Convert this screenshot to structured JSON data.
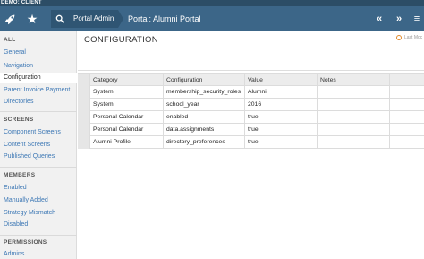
{
  "demo_bar": {
    "label": "DEMO: CLIENT"
  },
  "header": {
    "breadcrumb_label": "Portal Admin",
    "title": "Portal: Alumni Portal",
    "icons": {
      "rocket": "rocket-icon",
      "star": "star-icon",
      "search": "search-icon",
      "prev": "double-chevron-left-icon",
      "next": "double-chevron-right-icon",
      "menu": "menu-icon"
    },
    "prev_glyph": "«",
    "next_glyph": "»",
    "menu_glyph": "≡",
    "star_glyph": "★"
  },
  "sidebar": {
    "sections": [
      {
        "title": "ALL",
        "items": [
          {
            "label": "General",
            "active": false
          },
          {
            "label": "Navigation",
            "active": false
          },
          {
            "label": "Configuration",
            "active": true
          },
          {
            "label": "Parent Invoice Payment",
            "active": false
          },
          {
            "label": "Directories",
            "active": false
          }
        ]
      },
      {
        "title": "SCREENS",
        "items": [
          {
            "label": "Component Screens",
            "active": false
          },
          {
            "label": "Content Screens",
            "active": false
          },
          {
            "label": "Published Queries",
            "active": false
          }
        ]
      },
      {
        "title": "MEMBERS",
        "items": [
          {
            "label": "Enabled",
            "active": false
          },
          {
            "label": "Manually Added",
            "active": false
          },
          {
            "label": "Strategy Mismatch",
            "active": false
          },
          {
            "label": "Disabled",
            "active": false
          }
        ]
      },
      {
        "title": "PERMISSIONS",
        "items": [
          {
            "label": "Admins",
            "active": false
          }
        ]
      }
    ]
  },
  "main": {
    "page_title": "CONFIGURATION",
    "last_modified": "Last Moc",
    "table": {
      "columns": [
        "Category",
        "Configuration",
        "Value",
        "Notes"
      ],
      "rows": [
        [
          "System",
          "membership_security_roles",
          "Alumni",
          ""
        ],
        [
          "System",
          "school_year",
          "2016",
          ""
        ],
        [
          "Personal Calendar",
          "enabled",
          "true",
          ""
        ],
        [
          "Personal Calendar",
          "data.assignments",
          "true",
          ""
        ],
        [
          "Alumni Profile",
          "directory_preferences",
          "true",
          ""
        ]
      ]
    }
  },
  "colors": {
    "header": "#3c6688",
    "demo_bar": "#2c4d66",
    "link": "#3d78b5",
    "accent_clock": "#e08a2b"
  }
}
